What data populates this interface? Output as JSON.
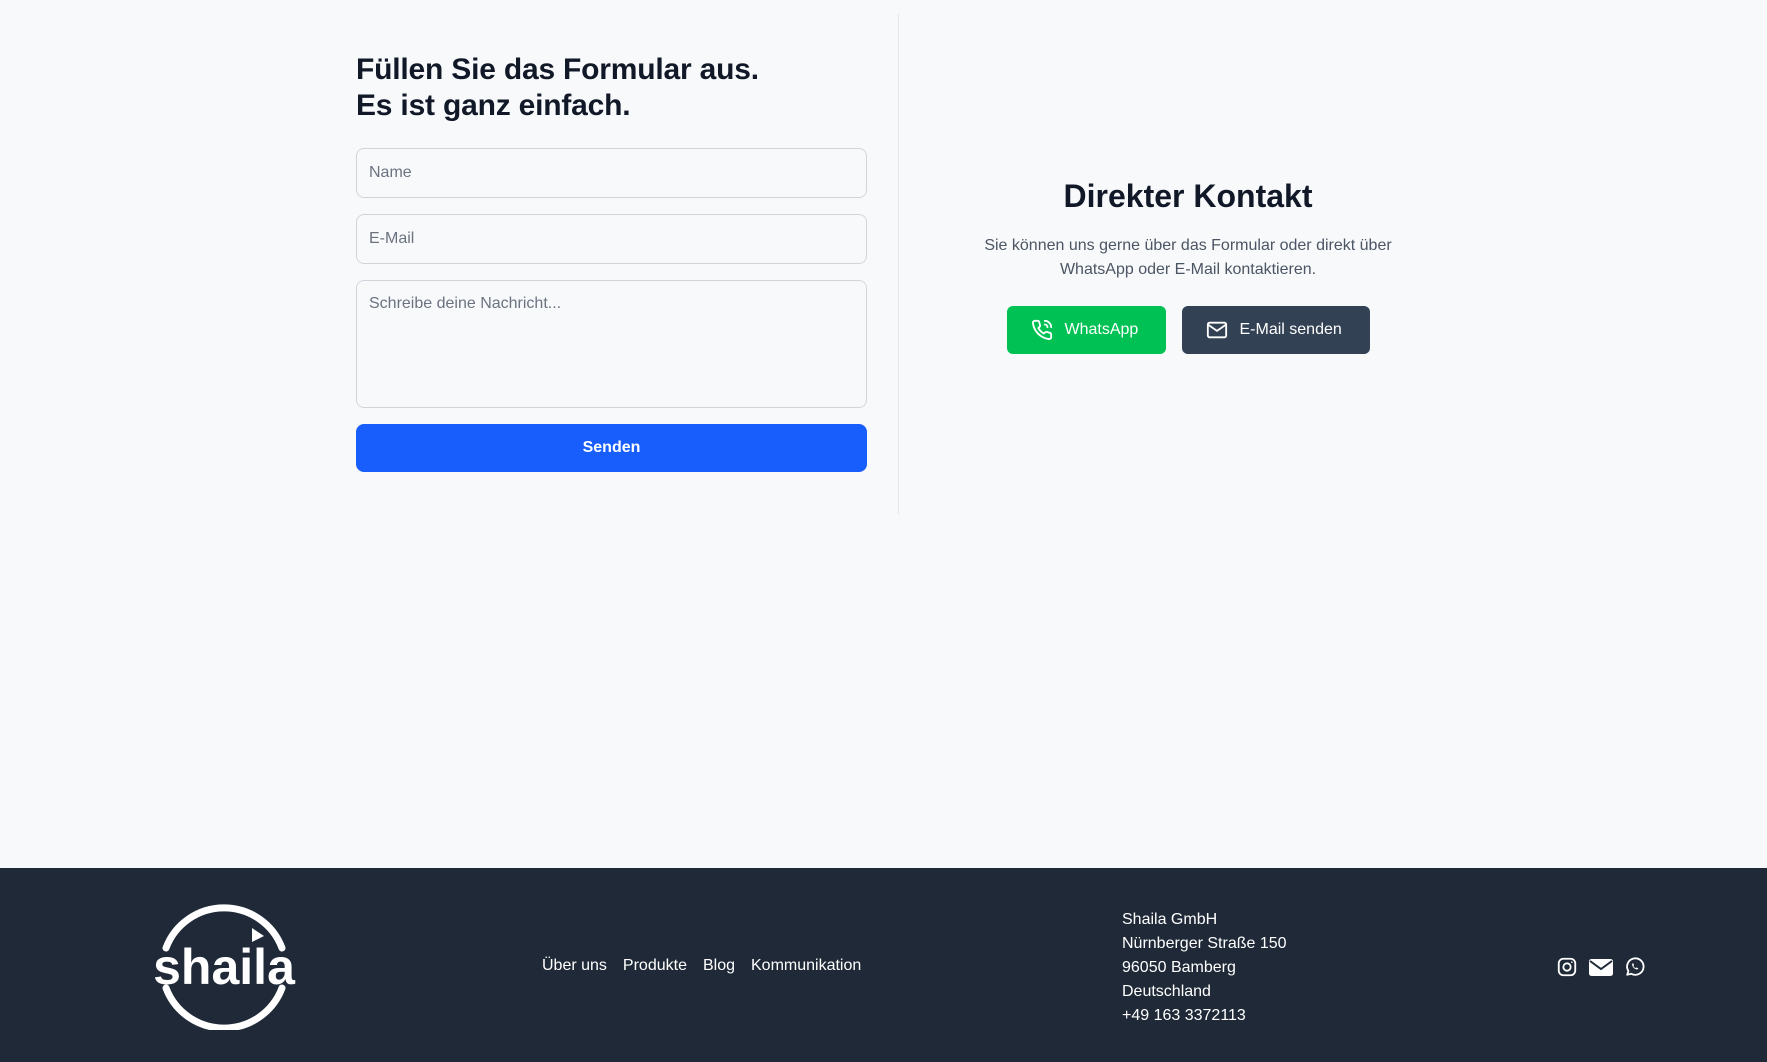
{
  "form": {
    "title_line1": "Füllen Sie das Formular aus.",
    "title_line2": "Es ist ganz einfach.",
    "name_placeholder": "Name",
    "email_placeholder": "E-Mail",
    "message_placeholder": "Schreibe deine Nachricht...",
    "submit_label": "Senden"
  },
  "contact": {
    "title": "Direkter Kontakt",
    "text_line1": "Sie können uns gerne über das Formular oder direkt über",
    "text_line2": "WhatsApp oder E-Mail kontaktieren.",
    "whatsapp_label": "WhatsApp",
    "email_label": "E-Mail senden",
    "whatsapp_icon": "phone-icon",
    "email_icon": "mail-icon"
  },
  "footer": {
    "logo_text": "shaila",
    "nav": [
      "Über uns",
      "Produkte",
      "Blog",
      "Kommunikation"
    ],
    "address": {
      "company": "Shaila GmbH",
      "street": "Nürnberger Straße 150",
      "city": "96050 Bamberg",
      "country": "Deutschland",
      "phone": "+49 163 3372113"
    },
    "social_icons": [
      "instagram-icon",
      "envelope-icon",
      "whatsapp-icon"
    ]
  },
  "colors": {
    "background": "#f8f9fb",
    "primary": "#175efc",
    "whatsapp": "#00c153",
    "email_button": "#334155",
    "footer": "#1f2937"
  }
}
